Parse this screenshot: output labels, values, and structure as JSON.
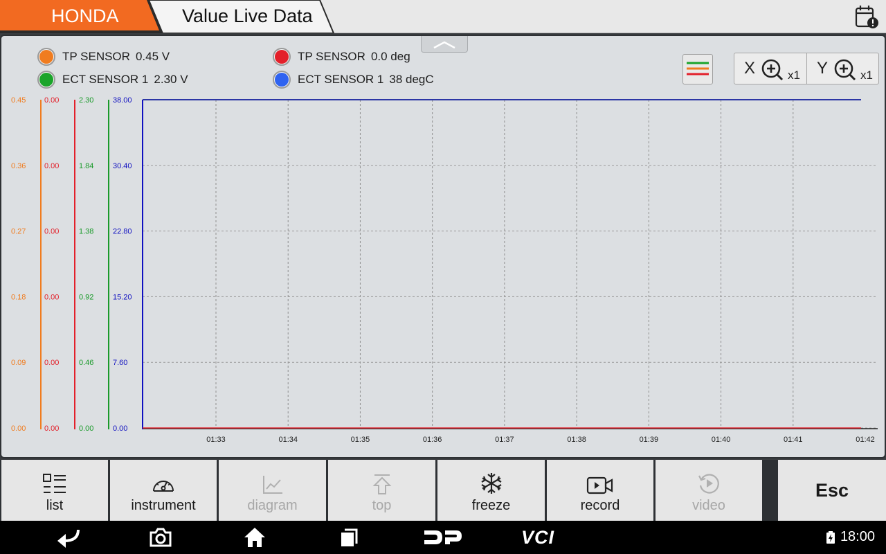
{
  "header": {
    "brand": "HONDA",
    "title": "Value Live Data",
    "brand_color": "#f26a21"
  },
  "legend": [
    {
      "name": "TP SENSOR",
      "value": "0.45 V",
      "color": "#f07c1f"
    },
    {
      "name": "TP SENSOR",
      "value": "0.0 deg",
      "color": "#e3202a"
    },
    {
      "name": "ECT SENSOR 1",
      "value": "2.30 V",
      "color": "#1aa42a"
    },
    {
      "name": "ECT SENSOR 1",
      "value": "38 degC",
      "color": "#2f63f0"
    }
  ],
  "zoom": {
    "x_axis": "X",
    "x_mult": "x1",
    "y_axis": "Y",
    "y_mult": "x1"
  },
  "chart_data": {
    "type": "line",
    "x": [
      "01:33",
      "01:34",
      "01:35",
      "01:36",
      "01:37",
      "01:38",
      "01:39",
      "01:40",
      "01:41",
      "01:42"
    ],
    "axes": [
      {
        "color": "#f07c1f",
        "ticks": [
          "0.45",
          "0.36",
          "0.27",
          "0.18",
          "0.09",
          "0.00"
        ],
        "ylim": [
          0,
          0.45
        ]
      },
      {
        "color": "#e3202a",
        "ticks": [
          "0.00",
          "0.00",
          "0.00",
          "0.00",
          "0.00",
          "0.00"
        ],
        "ylim": [
          0,
          0
        ]
      },
      {
        "color": "#1a9a2a",
        "ticks": [
          "2.30",
          "1.84",
          "1.38",
          "0.92",
          "0.46",
          "0.00"
        ],
        "ylim": [
          0,
          2.3
        ]
      },
      {
        "color": "#1010c0",
        "ticks": [
          "38.00",
          "30.40",
          "22.80",
          "15.20",
          "7.60",
          "0.00"
        ],
        "ylim": [
          0,
          38.0
        ]
      }
    ],
    "series": [
      {
        "name": "TP SENSOR",
        "unit": "V",
        "values": [
          0.45,
          0.45,
          0.45,
          0.45,
          0.45,
          0.45,
          0.45,
          0.45,
          0.45,
          0.45
        ]
      },
      {
        "name": "TP SENSOR",
        "unit": "deg",
        "values": [
          0.0,
          0.0,
          0.0,
          0.0,
          0.0,
          0.0,
          0.0,
          0.0,
          0.0,
          0.0
        ]
      },
      {
        "name": "ECT SENSOR 1",
        "unit": "V",
        "values": [
          2.3,
          2.3,
          2.3,
          2.3,
          2.3,
          2.3,
          2.3,
          2.3,
          2.3,
          2.3
        ]
      },
      {
        "name": "ECT SENSOR 1",
        "unit": "degC",
        "values": [
          38,
          38,
          38,
          38,
          38,
          38,
          38,
          38,
          38,
          38
        ]
      }
    ],
    "grid": true
  },
  "toolbar": [
    {
      "label": "list",
      "icon": "list-icon",
      "enabled": true
    },
    {
      "label": "instrument",
      "icon": "gauge-icon",
      "enabled": true
    },
    {
      "label": "diagram",
      "icon": "line-chart-icon",
      "enabled": false
    },
    {
      "label": "top",
      "icon": "arrow-up-icon",
      "enabled": false
    },
    {
      "label": "freeze",
      "icon": "snowflake-icon",
      "enabled": true
    },
    {
      "label": "record",
      "icon": "video-camera-icon",
      "enabled": true
    },
    {
      "label": "video",
      "icon": "replay-icon",
      "enabled": false
    },
    {
      "label": "Esc",
      "icon": "",
      "enabled": true
    }
  ],
  "navbar": {
    "dp_label": "DP",
    "vci_label": "VCI",
    "time": "18:00"
  }
}
